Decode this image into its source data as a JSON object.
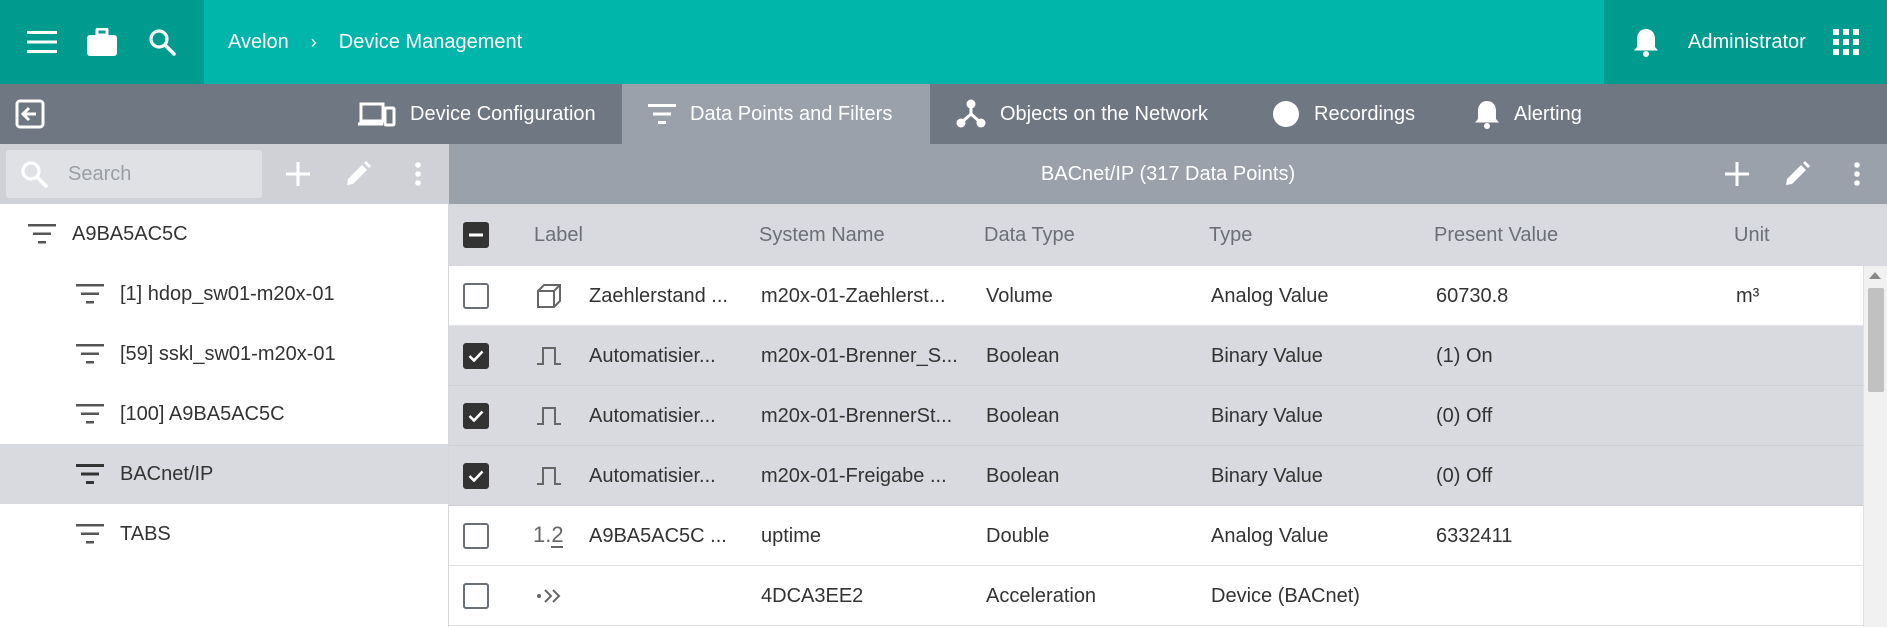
{
  "topbar": {
    "breadcrumb": [
      "Avelon",
      "Device Management"
    ],
    "breadcrumb_separator": "›",
    "user": "Administrator",
    "icons": [
      "menu-icon",
      "briefcase-icon",
      "search-icon",
      "bell-icon",
      "apps-grid-icon"
    ],
    "accent": "#00b5a9",
    "accent_dark": "#009b8f"
  },
  "tabs": [
    {
      "label": "Device Configuration",
      "icon": "devices-icon",
      "active": false
    },
    {
      "label": "Data Points and Filters",
      "icon": "filter-icon",
      "active": true
    },
    {
      "label": "Objects on the Network",
      "icon": "network-icon",
      "active": false
    },
    {
      "label": "Recordings",
      "icon": "record-icon",
      "active": false
    },
    {
      "label": "Alerting",
      "icon": "bell-icon",
      "active": false
    }
  ],
  "left_panel": {
    "search_placeholder": "Search",
    "tree": [
      {
        "label": "A9BA5AC5C",
        "level": 0,
        "selected": false
      },
      {
        "label": "[1] hdop_sw01-m20x-01",
        "level": 1,
        "selected": false
      },
      {
        "label": "[59] sskl_sw01-m20x-01",
        "level": 1,
        "selected": false
      },
      {
        "label": "[100] A9BA5AC5C",
        "level": 1,
        "selected": false
      },
      {
        "label": "BACnet/IP",
        "level": 1,
        "selected": true
      },
      {
        "label": "TABS",
        "level": 1,
        "selected": false
      }
    ]
  },
  "table": {
    "title": "BACnet/IP (317  Data Points)",
    "columns": [
      "Label",
      "System Name",
      "Data Type",
      "Type",
      "Present Value",
      "Unit"
    ],
    "rows": [
      {
        "checked": false,
        "icon": "cube-icon",
        "label": "Zaehlerstand ...",
        "system_name": "m20x-01-Zaehlerst...",
        "data_type": "Volume",
        "type": "Analog Value",
        "present_value": "60730.8",
        "unit": "m³"
      },
      {
        "checked": true,
        "icon": "pulse-icon",
        "label": "Automatisier...",
        "system_name": "m20x-01-Brenner_S...",
        "data_type": "Boolean",
        "type": "Binary Value",
        "present_value": "(1) On",
        "unit": ""
      },
      {
        "checked": true,
        "icon": "pulse-icon",
        "label": "Automatisier...",
        "system_name": "m20x-01-BrennerSt...",
        "data_type": "Boolean",
        "type": "Binary Value",
        "present_value": "(0) Off",
        "unit": ""
      },
      {
        "checked": true,
        "icon": "pulse-icon",
        "label": "Automatisier...",
        "system_name": "m20x-01-Freigabe ...",
        "data_type": "Boolean",
        "type": "Binary Value",
        "present_value": "(0) Off",
        "unit": ""
      },
      {
        "checked": false,
        "icon": "decimal-icon",
        "label": "A9BA5AC5C ...",
        "system_name": "uptime",
        "data_type": "Double",
        "type": "Analog Value",
        "present_value": "6332411",
        "unit": ""
      },
      {
        "checked": false,
        "icon": "chevrons-right-icon",
        "label": "",
        "system_name": "4DCA3EE2",
        "data_type": "Acceleration",
        "type": "Device (BACnet)",
        "present_value": "",
        "unit": ""
      }
    ]
  }
}
